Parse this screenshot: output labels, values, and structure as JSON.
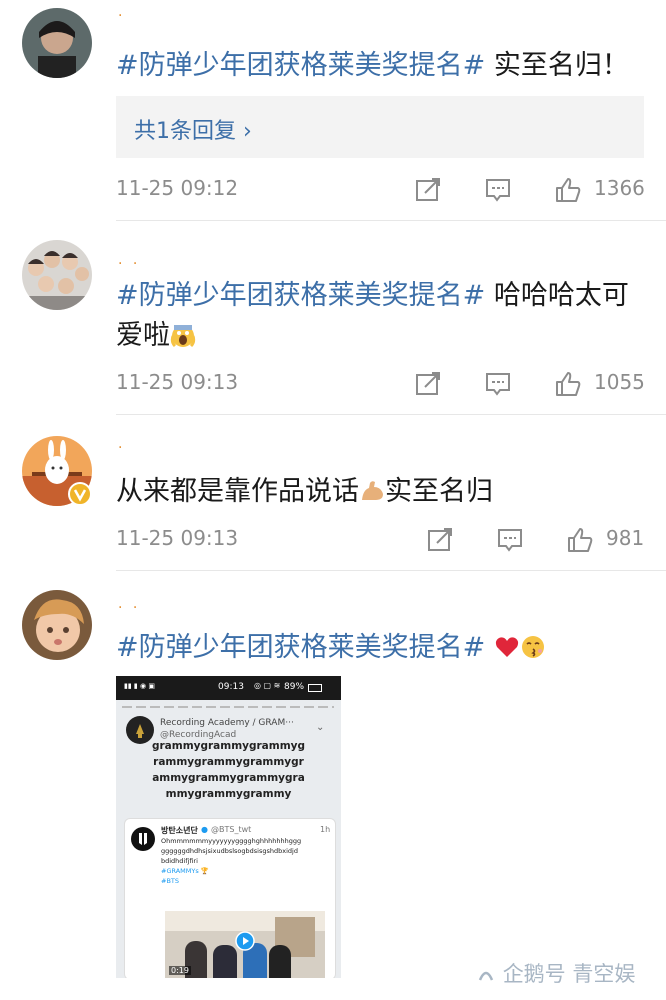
{
  "comments": [
    {
      "dots": "·",
      "tag": "#防弹少年团获格莱美奖提名#",
      "body": " 实至名归！",
      "reply_label": "共1条回复 ›",
      "time": "11-25 09:12",
      "likes": "1366"
    },
    {
      "dots": "· ·",
      "tag": "#防弹少年团获格莱美奖提名#",
      "body": " 哈哈哈太可",
      "body2": "爱啦",
      "time": "11-25 09:13",
      "likes": "1055"
    },
    {
      "dots": "·",
      "body_a": "从来都是靠作品说话",
      "body_b": "实至名归",
      "time": "11-25 09:13",
      "likes": "981"
    },
    {
      "dots": "· ·",
      "tag": "#防弹少年团获格莱美奖提名#"
    }
  ],
  "screenshot": {
    "status_time": "09:13",
    "battery": "89%",
    "account": "Recording Academy / GRAM···",
    "handle": "@RecordingAcad",
    "tweet_lines": [
      "grammygrammygrammyg",
      "rammygrammygrammygr",
      "ammygrammygrammygra",
      "mmygrammygrammy"
    ],
    "quote_name": "방탄소년단",
    "quote_handle": "@BTS_twt",
    "quote_time": "1h",
    "quote_lines": [
      "Ohmmmmmmyyyyyyygggghghhhhhhhggg",
      "ggggggdhdhsjsixudbslsogbdsisgshdbxidjd",
      "bdidhdifjfiri"
    ],
    "hashtag1": "#GRAMMYs",
    "hashtag2": "#BTS",
    "video_time": "0:19"
  },
  "watermark": "企鹅号 青空娱",
  "icons": [
    "share-icon",
    "comment-icon",
    "like-icon"
  ],
  "colors": {
    "tag": "#3d6fa8",
    "meta": "#8c8c8c"
  }
}
